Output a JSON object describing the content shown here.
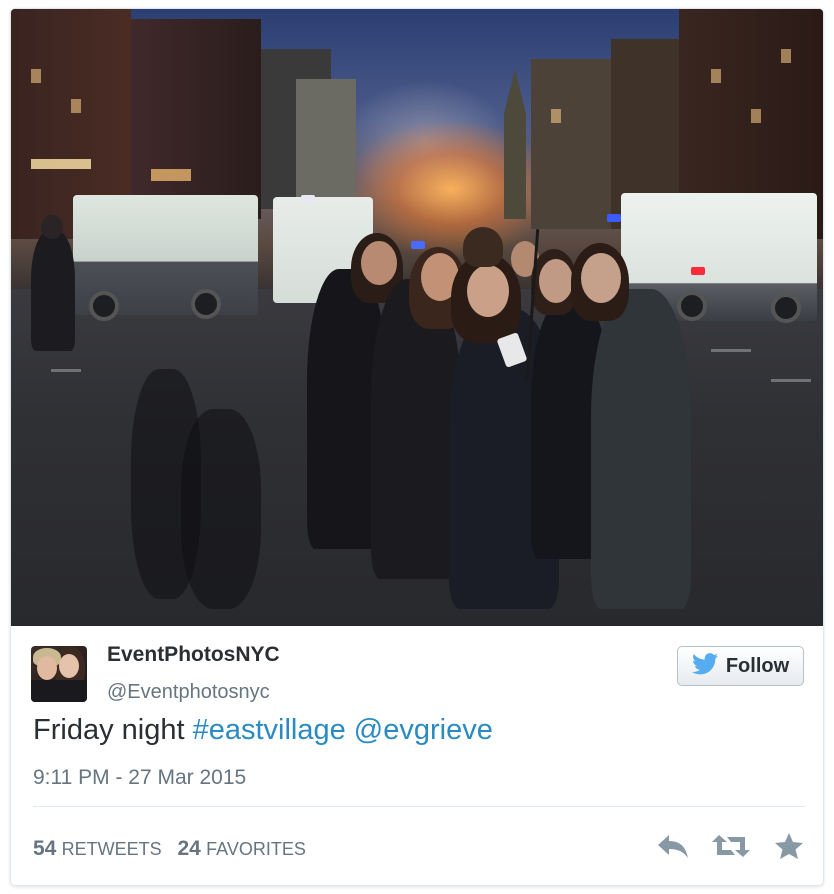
{
  "tweet": {
    "display_name": "EventPhotosNYC",
    "handle": "@Eventphotosnyc",
    "follow_label": "Follow",
    "text_plain": "Friday night ",
    "hashtag": "#eastvillage",
    "mention": "@evgrieve",
    "timestamp": "9:11 PM - 27 Mar 2015",
    "retweets_count": "54",
    "retweets_label": "RETWEETS",
    "favorites_count": "24",
    "favorites_label": "FAVORITES"
  },
  "icons": {
    "follow": "twitter-bird-icon",
    "reply": "reply-icon",
    "retweet": "retweet-icon",
    "favorite": "star-icon"
  },
  "colors": {
    "link": "#2a8bc4",
    "muted": "#66757f",
    "text": "#292f33",
    "twitter_blue": "#55acee",
    "icon_gray": "#8899a6"
  }
}
